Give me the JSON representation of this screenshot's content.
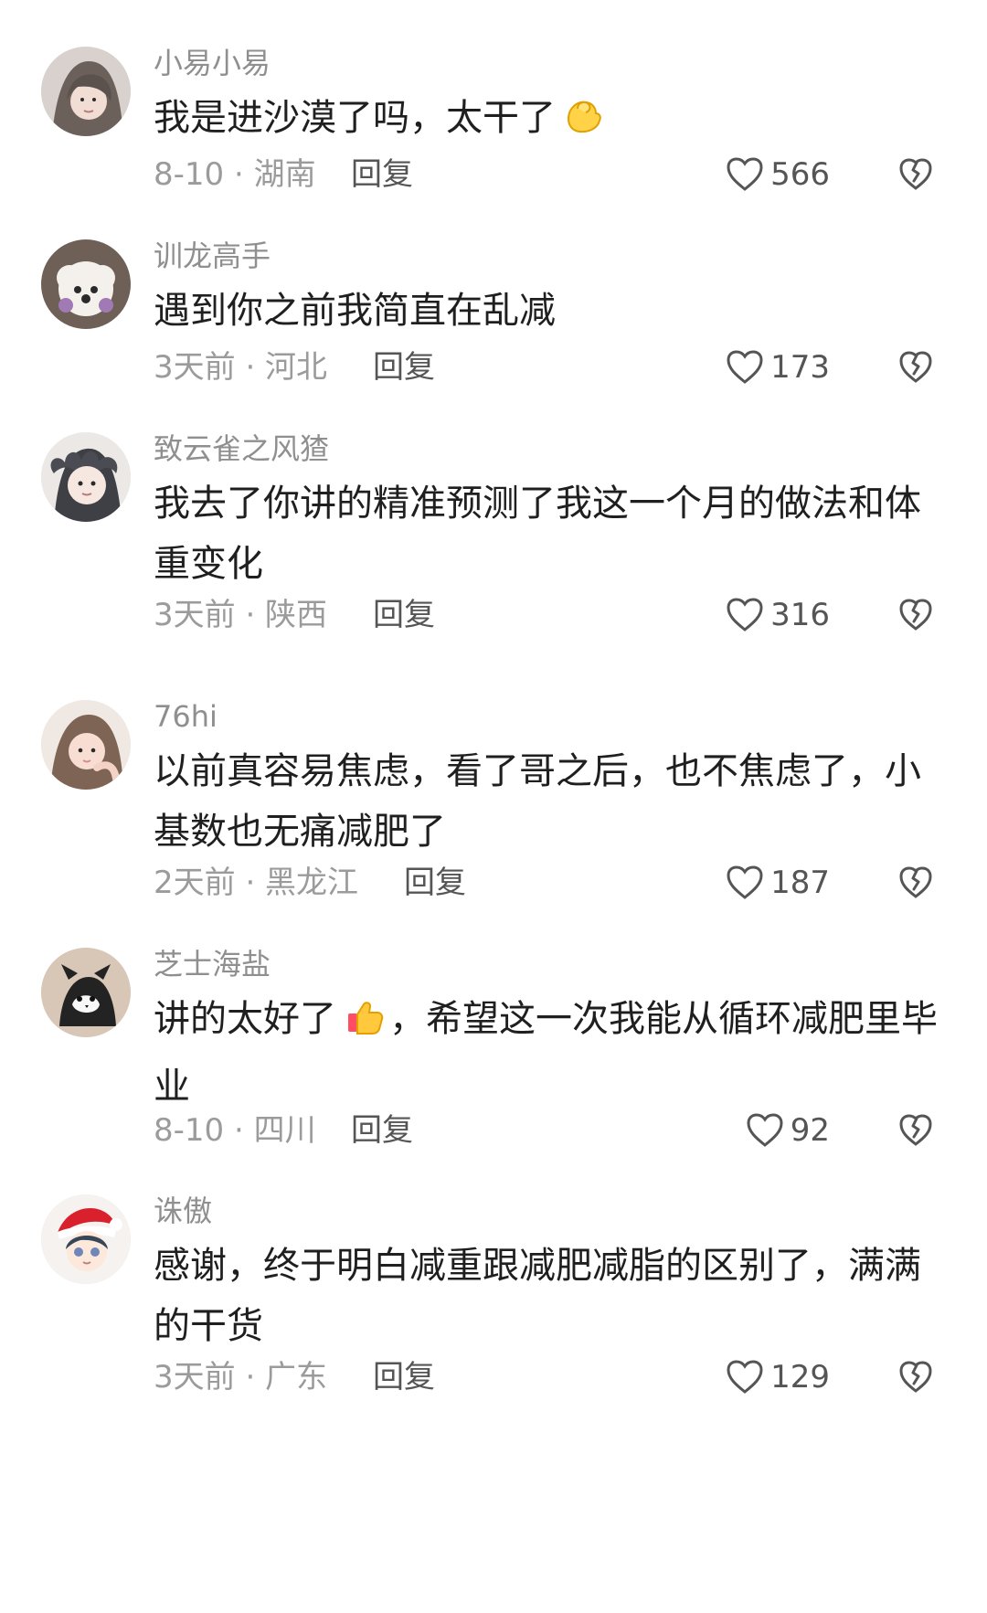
{
  "comments": [
    {
      "username": "小易小易",
      "text": "我是进沙漠了吗，太干了",
      "emoji": "muscle-emoji",
      "meta": "8-10 · 湖南",
      "reply_label": "回复",
      "likes": "566"
    },
    {
      "username": "训龙高手",
      "text": "遇到你之前我简直在乱减",
      "meta": "3天前 · 河北",
      "reply_label": "回复",
      "likes": "173"
    },
    {
      "username": "致云雀之风猹",
      "text": "我去了你讲的精准预测了我这一个月的做法和体重变化",
      "meta": "3天前 · 陕西",
      "reply_label": "回复",
      "likes": "316"
    },
    {
      "username": "76hi",
      "text": "以前真容易焦虑，看了哥之后，也不焦虑了，小基数也无痛减肥了",
      "meta": "2天前 · 黑龙江",
      "reply_label": "回复",
      "likes": "187"
    },
    {
      "username": "芝士海盐",
      "text_before": "讲的太好了",
      "emoji": "thumbs-up-emoji",
      "text_after": "，希望这一次我能从循环减肥里毕业",
      "meta": "8-10 · 四川",
      "reply_label": "回复",
      "likes": "92"
    },
    {
      "username": "诛傲",
      "text": "感谢，终于明白减重跟减肥减脂的区别了，满满的干货",
      "meta": "3天前 · 广东",
      "reply_label": "回复",
      "likes": "129"
    }
  ],
  "icons": {
    "like": "heart-outline-icon",
    "dislike": "broken-heart-icon"
  },
  "colors": {
    "text": "#1f1f1f",
    "username": "#8f8f8f",
    "meta": "#9b9b9b",
    "action": "#555555",
    "background": "#ffffff"
  }
}
